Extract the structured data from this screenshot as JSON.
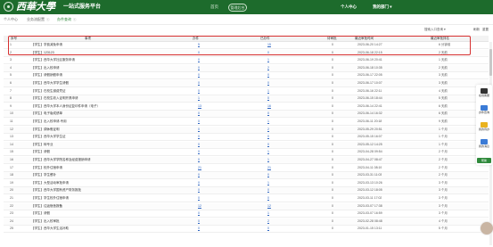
{
  "header": {
    "university": "西華大學",
    "platform": "一站式服务平台",
    "nav": [
      "首页"
    ],
    "mgmt": "管理后台",
    "user_center": "个人中心",
    "my_dept": "我的部门 ▾"
  },
  "tabs": [
    {
      "label": "个人中心"
    },
    {
      "label": "业务流配置"
    },
    {
      "label": "办件查询"
    }
  ],
  "tools": {
    "search": "搜索入口查询 ▾",
    "btn1": "刷新",
    "btn2": "重置"
  },
  "table": {
    "headers": [
      "序号",
      "事项",
      "办件",
      "已办件",
      "待审批",
      "最近审批时间",
      "最近审批排名"
    ],
    "rows": [
      {
        "no": "1",
        "title": "【学生】学费减免申请",
        "a": "5",
        "b": "15",
        "c": "0",
        "d": "2023-06-20 14:27",
        "e": "6 分钟前"
      },
      {
        "no": "2",
        "title": "【学生】123123",
        "a": "0",
        "b": "0",
        "c": "0",
        "d": "2023-06-18 22:15",
        "e": "2 天前"
      },
      {
        "no": "3",
        "title": "【学生】西华大学社区服务申请",
        "a": "0",
        "b": "1",
        "c": "0",
        "d": "2023-06-19 20:41",
        "e": "1 天前"
      },
      {
        "no": "4",
        "title": "【学生】出入校申请",
        "a": "0",
        "b": "2",
        "c": "0",
        "d": "2023-06-18 10:35",
        "e": "2 天前"
      },
      {
        "no": "5",
        "title": "【学生】请假销假申请",
        "a": "0",
        "b": "0",
        "c": "0",
        "d": "2023-06-17 22:05",
        "e": "3 天前"
      },
      {
        "no": "6",
        "title": "【学生】西华大学学生请假",
        "a": "0",
        "b": "0",
        "c": "0",
        "d": "2023-06-17 10:07",
        "e": "3 天前"
      },
      {
        "no": "7",
        "title": "【学生】在校生缴费凭证",
        "a": "0",
        "b": "1",
        "c": "0",
        "d": "2023-06-16 22:11",
        "e": "4 天前"
      },
      {
        "no": "8",
        "title": "【学生】在校生收入证明开具申请",
        "a": "1",
        "b": "0",
        "c": "0",
        "d": "2023-06-15 18:44",
        "e": "5 天前"
      },
      {
        "no": "9",
        "title": "【学生】西华大学本人身份证复印件申请（电子）",
        "a": "13",
        "b": "16",
        "c": "0",
        "d": "2023-06-14 22:41",
        "e": "6 天前"
      },
      {
        "no": "10",
        "title": "【学生】电子版成绩单",
        "a": "0",
        "b": "0",
        "c": "0",
        "d": "2023-06-14 16:32",
        "e": "6 天前"
      },
      {
        "no": "11",
        "title": "【学生】出入校申请-专用",
        "a": "0",
        "b": "1",
        "c": "0",
        "d": "2023-06-11 20:18",
        "e": "9 天前"
      },
      {
        "no": "12",
        "title": "【学生】调休假证明",
        "a": "0",
        "b": "2",
        "c": "0",
        "d": "2023-05-29 20:51",
        "e": "1 个月"
      },
      {
        "no": "13",
        "title": "【学生】西华大学学生证",
        "a": "0",
        "b": "0",
        "c": "0",
        "d": "2023-05-15 16:07",
        "e": "1 个月"
      },
      {
        "no": "14",
        "title": "【学生】转专业",
        "a": "0",
        "b": "0",
        "c": "0",
        "d": "2023-05-12 14:25",
        "e": "1 个月"
      },
      {
        "no": "15",
        "title": "【学生】请假",
        "a": "0",
        "b": "1",
        "c": "0",
        "d": "2023-04-28 09:54",
        "e": "2 个月"
      },
      {
        "no": "16",
        "title": "【学生】西华大学学院名称及经费报销申请",
        "a": "0",
        "b": "1",
        "c": "0",
        "d": "2023-04-27 08:47",
        "e": "2 个月"
      },
      {
        "no": "17",
        "title": "【学生】校外住宿申请",
        "a": "21",
        "b": "21",
        "c": "0",
        "d": "2023-04-11 08:19",
        "e": "2 个月"
      },
      {
        "no": "18",
        "title": "【学生】学生餐补",
        "a": "0",
        "b": "0",
        "c": "0",
        "d": "2023-03-31 11:03",
        "e": "2 个月"
      },
      {
        "no": "19",
        "title": "【学生】大型活动审批申请",
        "a": "0",
        "b": "1",
        "c": "0",
        "d": "2023-03-13 10:26",
        "e": "3 个月"
      },
      {
        "no": "20",
        "title": "【学生】西华大学国有资产财务报批",
        "a": "0",
        "b": "0",
        "c": "0",
        "d": "2023-03-12 18:05",
        "e": "3 个月"
      },
      {
        "no": "21",
        "title": "【学生】学生校外住宿申请",
        "a": "0",
        "b": "0",
        "c": "0",
        "d": "2023-03-11 17:02",
        "e": "3 个月"
      },
      {
        "no": "22",
        "title": "【学生】往返宿舍报备",
        "a": "12",
        "b": "12",
        "c": "0",
        "d": "2023-03-07 17:38",
        "e": "3 个月"
      },
      {
        "no": "23",
        "title": "【学生】请假",
        "a": "0",
        "b": "1",
        "c": "0",
        "d": "2023-03-07 16:59",
        "e": "3 个月"
      },
      {
        "no": "24",
        "title": "【学生】出入校审批",
        "a": "0",
        "b": "2",
        "c": "0",
        "d": "2023-02-28 08:48",
        "e": "4 个月"
      },
      {
        "no": "25",
        "title": "【学生】西华大学生活补助",
        "a": "0",
        "b": "0",
        "c": "0",
        "d": "2023-01-15 13:11",
        "e": "5 个月"
      }
    ]
  },
  "side_widgets": [
    {
      "label": "在线客服",
      "color": "#333333"
    },
    {
      "label": "办件查询",
      "color": "#3b7bd6"
    },
    {
      "label": "我的待办",
      "color": "#e9b21f"
    },
    {
      "label": "我的消息",
      "color": "#3b7bd6"
    }
  ],
  "side_button": "帮助"
}
